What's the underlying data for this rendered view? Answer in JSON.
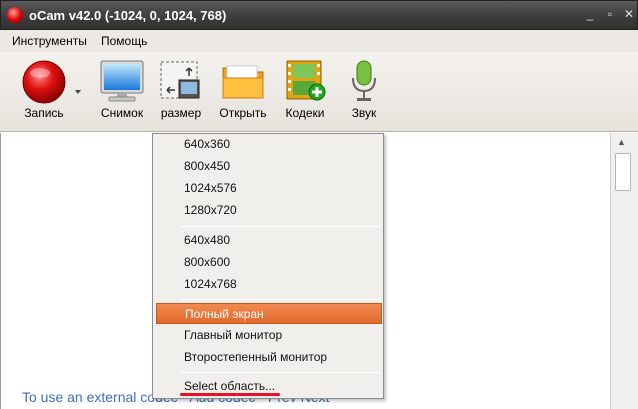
{
  "window": {
    "title": "oCam v42.0 (-1024, 0, 1024, 768)"
  },
  "menubar": {
    "items": [
      "Инструменты",
      "Помощь"
    ]
  },
  "toolbar": {
    "record_label": "Запись",
    "snapshot_label": "Снимок",
    "size_label": "размер",
    "open_label": "Открыть",
    "codecs_label": "Кодеки",
    "sound_label": "Звук"
  },
  "size_menu": {
    "group1": [
      "640x360",
      "800x450",
      "1024x576",
      "1280x720"
    ],
    "group2": [
      "640x480",
      "800x600",
      "1024x768"
    ],
    "group3": [
      "Полный экран",
      "Главный монитор",
      "Второстепенный монитор"
    ],
    "selected": "Полный экран",
    "select_area": "Select область..."
  },
  "content": {
    "footer_link": "To use an external codec - Add codec - Prev Next"
  },
  "colors": {
    "accent": "#e8702f",
    "link": "#3b6fbd",
    "underline": "#e8102a"
  }
}
